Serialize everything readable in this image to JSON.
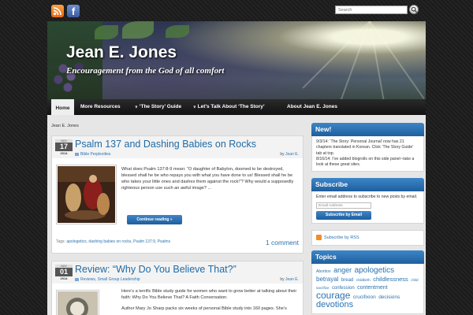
{
  "top": {
    "search_placeholder": "Search",
    "icons": [
      "rss-icon",
      "facebook-icon",
      "search-icon"
    ]
  },
  "header": {
    "title": "Jean E. Jones",
    "tagline": "Encouragement from the God of all comfort"
  },
  "nav": {
    "items": [
      {
        "label": "Home",
        "active": true
      },
      {
        "label": "More Resources"
      },
      {
        "label": "‘The Story’ Guide",
        "dropdown": true
      },
      {
        "label": "Let’s Talk About ‘The Story’",
        "dropdown": true
      },
      {
        "label": "About Jean E. Jones"
      }
    ]
  },
  "breadcrumb": "Jean E. Jones",
  "posts": [
    {
      "month": "NOV",
      "day": "17",
      "year": "2014",
      "title": "Psalm 137 and Dashing Babies on Rocks",
      "category": "Bible Perplexities",
      "by": "by",
      "author": "Jean E.",
      "excerpt": "What does Psalm 137:8-9 mean: “O daughter of Babylon, doomed to be destroyed, blessed shall he be who repays you with what you have done to us! Blessed shall he be who takes your little ones and dashes them against the rock!”? Why would a supposedly righteous person use such an awful image? ...",
      "continue": "Continue reading »",
      "tags_label": "Tags:",
      "tags": [
        "apologetics,",
        "dashing babies on rocks,",
        "Psalm 137:9,",
        "Psalms"
      ],
      "comments": "1 comment"
    },
    {
      "month": "NOV",
      "day": "01",
      "year": "2014",
      "title": "Review: “Why Do You Believe That?”",
      "category": "Reviews, Small Group Leadership",
      "by": "by",
      "author": "Jean E.",
      "excerpt1": "Here’s a terrific Bible study guide for women who want to grow better at talking about their faith: Why Do You Believe That? A Faith Conversation.",
      "excerpt2": "Author Mary Jo Sharp packs six weeks of personal Bible study into 160 pages. She’s"
    }
  ],
  "sidebar": {
    "new_title": "New!",
    "new_text1": "9/3/14: ‘The Story: Personal Journal’ now has 21 chapters translated in Korean. Click ‘The Story Guide’ tab at top.",
    "new_text2": "8/16/14: I’ve added blogrolls on this side panel--take a look at these great sites.",
    "subscribe_title": "Subscribe",
    "subscribe_text": "Enter email address to subscribe to new posts by email.",
    "email_placeholder": "Email Address",
    "subscribe_button": "Subscribe by Email",
    "rss_text": "Subscribe by RSS",
    "topics_title": "Topics",
    "topics": [
      {
        "label": "Abortion",
        "size": 5
      },
      {
        "label": "anger",
        "size": 9
      },
      {
        "label": "apologetics",
        "size": 10
      },
      {
        "label": "betrayal",
        "size": 8
      },
      {
        "label": "bread",
        "size": 6
      },
      {
        "label": "childbirth",
        "size": 4.5
      },
      {
        "label": "childlessness",
        "size": 7.5
      },
      {
        "label": "child sacrifice",
        "size": 4.5
      },
      {
        "label": "confession",
        "size": 6
      },
      {
        "label": "contentment",
        "size": 7
      },
      {
        "label": "courage",
        "size": 12
      },
      {
        "label": "crucifixion",
        "size": 6.5
      },
      {
        "label": "decisions",
        "size": 6.5
      },
      {
        "label": "devotions",
        "size": 11
      }
    ]
  },
  "colors": {
    "accent": "#1f6aa5",
    "widget_header": "#2a70b2",
    "nav_bg": "#1c1c1c"
  }
}
